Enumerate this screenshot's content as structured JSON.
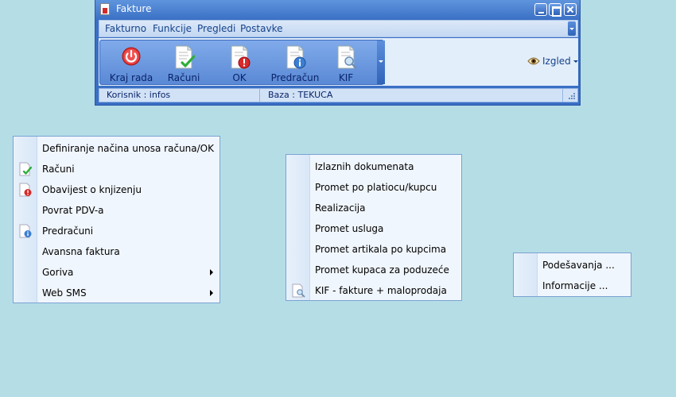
{
  "window": {
    "title": "Fakture"
  },
  "menubar": {
    "items": [
      "Fakturno",
      "Funkcije",
      "Pregledi",
      "Postavke"
    ]
  },
  "toolbar": {
    "buttons": [
      {
        "label": "Kraj rada",
        "icon": "power-icon"
      },
      {
        "label": "Računi",
        "icon": "document-check-icon"
      },
      {
        "label": "OK",
        "icon": "document-warning-icon"
      },
      {
        "label": "Predračun",
        "icon": "document-info-icon"
      },
      {
        "label": "KIF",
        "icon": "document-search-icon"
      }
    ],
    "izgled_label": "Izgled"
  },
  "statusbar": {
    "user": "Korisnik :  infos",
    "db": "Baza :  TEKUCA"
  },
  "menu_funkcije": {
    "items": [
      {
        "label": "Definiranje načina unosa računa/OK",
        "icon": "",
        "submenu": false
      },
      {
        "label": "Računi",
        "icon": "document-check-icon",
        "submenu": false
      },
      {
        "label": "Obavijest o knjizenju",
        "icon": "document-warning-icon",
        "submenu": false
      },
      {
        "label": "Povrat PDV-a",
        "icon": "",
        "submenu": false
      },
      {
        "label": "Predračuni",
        "icon": "document-info-icon",
        "submenu": false
      },
      {
        "label": "Avansna faktura",
        "icon": "",
        "submenu": false
      },
      {
        "label": "Goriva",
        "icon": "",
        "submenu": true
      },
      {
        "label": "Web SMS",
        "icon": "",
        "submenu": true
      }
    ]
  },
  "menu_pregledi": {
    "items": [
      {
        "label": "Izlaznih dokumenata",
        "icon": ""
      },
      {
        "label": "Promet po platiocu/kupcu",
        "icon": ""
      },
      {
        "label": "Realizacija",
        "icon": ""
      },
      {
        "label": "Promet usluga",
        "icon": ""
      },
      {
        "label": "Promet artikala po kupcima",
        "icon": ""
      },
      {
        "label": "Promet kupaca za poduzeće",
        "icon": ""
      },
      {
        "label": "KIF - fakture + maloprodaja",
        "icon": "document-search-icon"
      }
    ]
  },
  "menu_postavke": {
    "items": [
      {
        "label": "Podešavanja ..."
      },
      {
        "label": "Informacije ..."
      }
    ]
  },
  "colors": {
    "desktop": "#b5dde6",
    "title_bar": "#3c72c6",
    "menu_text": "#15428b",
    "toolbar_bg": "#5a89d5"
  }
}
